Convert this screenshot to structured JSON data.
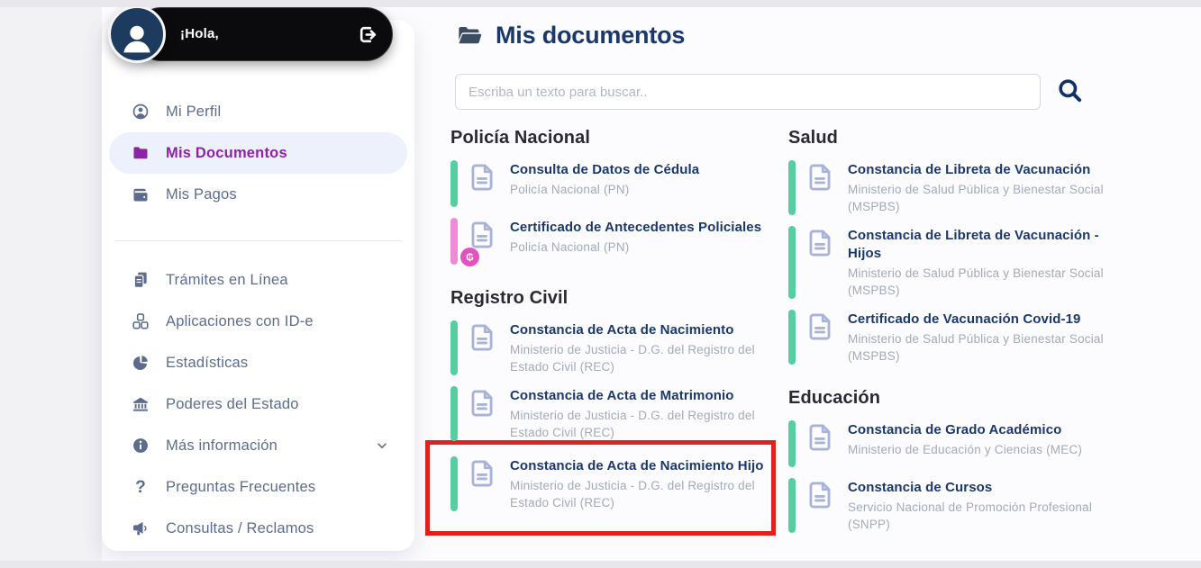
{
  "header": {
    "title": "Mis documentos"
  },
  "search": {
    "placeholder": "Escriba un texto para buscar.."
  },
  "sidebar": {
    "greeting": "¡Hola,",
    "primary": [
      {
        "label": "Mi Perfil",
        "icon": "user-circle",
        "active": false
      },
      {
        "label": "Mis Documentos",
        "icon": "folder",
        "active": true
      },
      {
        "label": "Mis Pagos",
        "icon": "wallet",
        "active": false
      }
    ],
    "secondary": [
      {
        "label": "Trámites en Línea",
        "icon": "files",
        "chevron": false
      },
      {
        "label": "Aplicaciones con ID-e",
        "icon": "cubes",
        "chevron": false
      },
      {
        "label": "Estadísticas",
        "icon": "pie",
        "chevron": false
      },
      {
        "label": "Poderes del Estado",
        "icon": "bank",
        "chevron": false
      },
      {
        "label": "Más información",
        "icon": "info",
        "chevron": true
      },
      {
        "label": "Preguntas Frecuentes",
        "icon": "question",
        "chevron": false
      },
      {
        "label": "Consultas / Reclamos",
        "icon": "megaphone",
        "chevron": false
      }
    ]
  },
  "sections": [
    {
      "title": "Policía Nacional",
      "column": 1,
      "items": [
        {
          "title": "Consulta de Datos de Cédula",
          "org": "Policía Nacional (PN)",
          "accent": "green"
        },
        {
          "title": "Certificado de Antecedentes Policiales",
          "org": "Policía Nacional (PN)",
          "accent": "pink",
          "badge": "₲"
        }
      ]
    },
    {
      "title": "Registro Civil",
      "column": 1,
      "items": [
        {
          "title": "Constancia de Acta de Nacimiento",
          "org": "Ministerio de Justicia - D.G. del Registro del Estado Civil (REC)",
          "accent": "green"
        },
        {
          "title": "Constancia de Acta de Matrimonio",
          "org": "Ministerio de Justicia - D.G. del Registro del Estado Civil (REC)",
          "accent": "green"
        },
        {
          "title": "Constancia de Acta de Nacimiento Hijo",
          "org": "Ministerio de Justicia - D.G. del Registro del Estado Civil (REC)",
          "accent": "green",
          "highlighted": true
        }
      ]
    },
    {
      "title": "Salud",
      "column": 2,
      "items": [
        {
          "title": "Constancia de Libreta de Vacunación",
          "org": "Ministerio de Salud Pública y Bienestar Social (MSPBS)",
          "accent": "green"
        },
        {
          "title": "Constancia de Libreta de Vacunación - Hijos",
          "org": "Ministerio de Salud Pública y Bienestar Social (MSPBS)",
          "accent": "green"
        },
        {
          "title": "Certificado de Vacunación Covid-19",
          "org": "Ministerio de Salud Pública y Bienestar Social (MSPBS)",
          "accent": "green"
        }
      ]
    },
    {
      "title": "Educación",
      "column": 2,
      "items": [
        {
          "title": "Constancia de Grado Académico",
          "org": "Ministerio de Educación y Ciencias (MEC)",
          "accent": "green"
        },
        {
          "title": "Constancia de Cursos",
          "org": "Servicio Nacional de Promoción Profesional (SNPP)",
          "accent": "green"
        }
      ]
    }
  ],
  "annotation": {
    "type": "red-box",
    "target": "Constancia de Acta de Nacimiento Hijo",
    "color": "#e41f1f"
  },
  "colors": {
    "accent_green": "#55cfa2",
    "accent_pink": "#f08ad6",
    "badge_pink": "#e353c0",
    "active_purple": "#8f23a8",
    "title_navy": "#1b386b",
    "annotation_red": "#e41f1f"
  }
}
